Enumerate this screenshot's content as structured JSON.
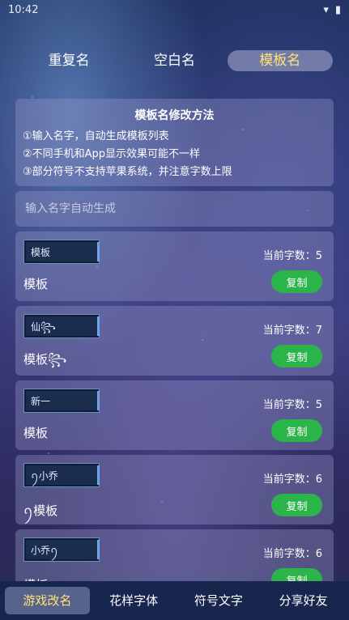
{
  "status": {
    "time": "10:42"
  },
  "tabs": [
    {
      "label": "重复名"
    },
    {
      "label": "空白名"
    },
    {
      "label": "模板名"
    }
  ],
  "info": {
    "title": "模板名修改方法",
    "lines": [
      "①输入名字，自动生成模板列表",
      "②不同手机和App显示效果可能不一样",
      "③部分符号不支持苹果系统，并注意字数上限"
    ]
  },
  "input": {
    "placeholder": "输入名字自动生成",
    "value": ""
  },
  "templates": [
    {
      "preview": "模板",
      "count": "当前字数：5",
      "name": "模板",
      "copy": "复制"
    },
    {
      "preview": "仙꧂",
      "count": "当前字数：7",
      "name": "模板꧂",
      "copy": "复制"
    },
    {
      "preview": "新一",
      "count": "当前字数：5",
      "name": "模板",
      "copy": "复制"
    },
    {
      "preview": "ꪆ小乔",
      "count": "当前字数：6",
      "name": "ꪆ模板",
      "copy": "复制"
    },
    {
      "preview": "小乔ꪆ",
      "count": "当前字数：6",
      "name": "模板ꪆ",
      "copy": "复制"
    }
  ],
  "bottom_nav": [
    {
      "label": "游戏改名"
    },
    {
      "label": "花样字体"
    },
    {
      "label": "符号文字"
    },
    {
      "label": "分享好友"
    }
  ],
  "colors": {
    "accent": "#ffe27a",
    "copy_button": "#2bb44a"
  }
}
